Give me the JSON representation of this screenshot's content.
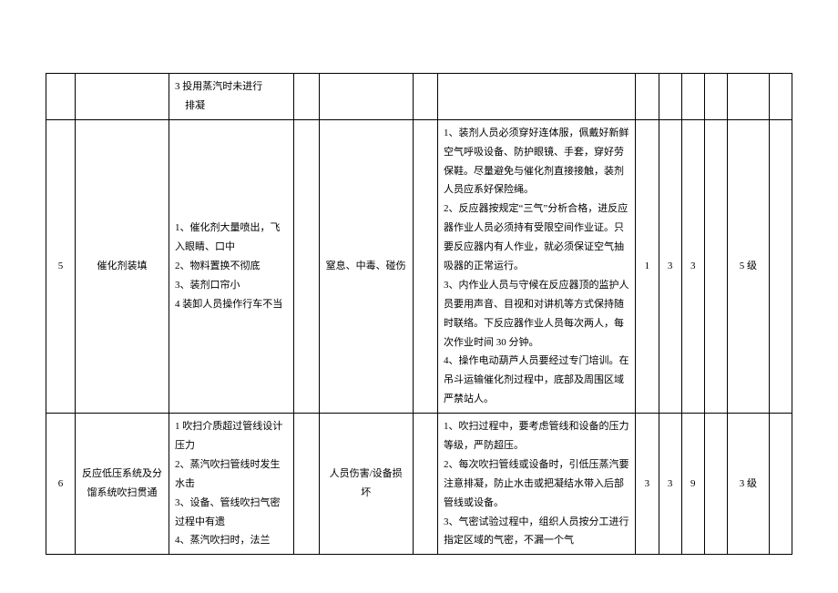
{
  "rows": [
    {
      "id": "",
      "step": "",
      "cause": "3 投用蒸汽时未进行排凝",
      "b1": "",
      "conseq": "",
      "b2": "",
      "measure": "",
      "n1": "",
      "n2": "",
      "n3": "",
      "b3": "",
      "level": "",
      "b4": ""
    },
    {
      "id": "5",
      "step": "催化剂装填",
      "cause": "1、催化剂大量喷出，飞入眼睛、口中\n2、物料置换不彻底\n3、装剂口帘小\n4 装卸人员操作行车不当",
      "b1": "",
      "conseq": "窒息、中毒、碰伤",
      "b2": "",
      "measure": "1、装剂人员必须穿好连体服，佩戴好新鲜空气呼吸设备、防护眼镜、手套，穿好劳保鞋。尽量避免与催化剂直接接触，装剂人员应系好保险绳。\n2、反应器按规定“三气”分析合格，进反应器作业人员必须持有受限空间作业证。只要反应器内有人作业，就必须保证空气抽吸器的正常运行。\n3、内作业人员与守候在反应器顶的监护人员要用声音、目视和对讲机等方式保持随时联络。下反应器作业人员每次两人，每次作业时间 30 分钟。\n4、操作电动葫芦人员要经过专门培训。在吊斗运输催化剂过程中，底部及周围区域严禁站人。",
      "n1": "1",
      "n2": "3",
      "n3": "3",
      "b3": "",
      "level": "5 级",
      "b4": ""
    },
    {
      "id": "6",
      "step": "反应低压系统及分馏系统吹扫贯通",
      "cause": "1 吹扫介质超过管线设计压力\n2、蒸汽吹扫管线时发生水击\n3、设备、管线吹扫气密过程中有遗\n4、蒸汽吹扫时，法兰",
      "b1": "",
      "conseq": "人员伤害/设备损坏",
      "b2": "",
      "measure": "1、吹扫过程中，要考虑管线和设备的压力等级，严防超压。\n2、每次吹扫管线或设备时，引低压蒸汽要注意排凝，防止水击或把凝结水带入后部管线或设备。\n3、气密试验过程中，组织人员按分工进行指定区域的气密，不漏一个气",
      "n1": "3",
      "n2": "3",
      "n3": "9",
      "b3": "",
      "level": "3 级",
      "b4": ""
    }
  ]
}
